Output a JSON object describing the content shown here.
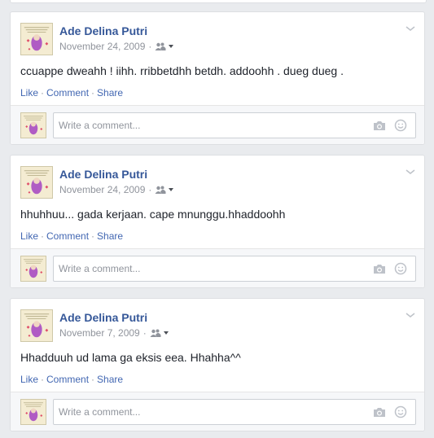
{
  "posts": [
    {
      "author": "Ade Delina Putri",
      "date": "November 24, 2009",
      "separator": "·",
      "text": "ccuappe dweahh ! iihh. rribbetdhh betdh. addoohh . dueg dueg .",
      "actions": {
        "like": "Like",
        "comment": "Comment",
        "share": "Share",
        "dot": "·"
      },
      "comment_placeholder": "Write a comment..."
    },
    {
      "author": "Ade Delina Putri",
      "date": "November 24, 2009",
      "separator": "·",
      "text": "hhuhhuu... gada kerjaan. cape mnunggu.hhaddoohh",
      "actions": {
        "like": "Like",
        "comment": "Comment",
        "share": "Share",
        "dot": "·"
      },
      "comment_placeholder": "Write a comment..."
    },
    {
      "author": "Ade Delina Putri",
      "date": "November 7, 2009",
      "separator": "·",
      "text": "Hhadduuh ud lama ga eksis eea. Hhahha^^",
      "actions": {
        "like": "Like",
        "comment": "Comment",
        "share": "Share",
        "dot": "·"
      },
      "comment_placeholder": "Write a comment..."
    }
  ],
  "icons": {
    "audience": "friends-audience-icon",
    "chevron": "chevron-down-icon",
    "camera": "camera-icon",
    "smiley": "smiley-icon"
  },
  "colors": {
    "background": "#e9ebee",
    "author_link": "#365899",
    "action_link": "#4267b2",
    "meta_text": "#90949c",
    "body_text": "#1d2129"
  }
}
